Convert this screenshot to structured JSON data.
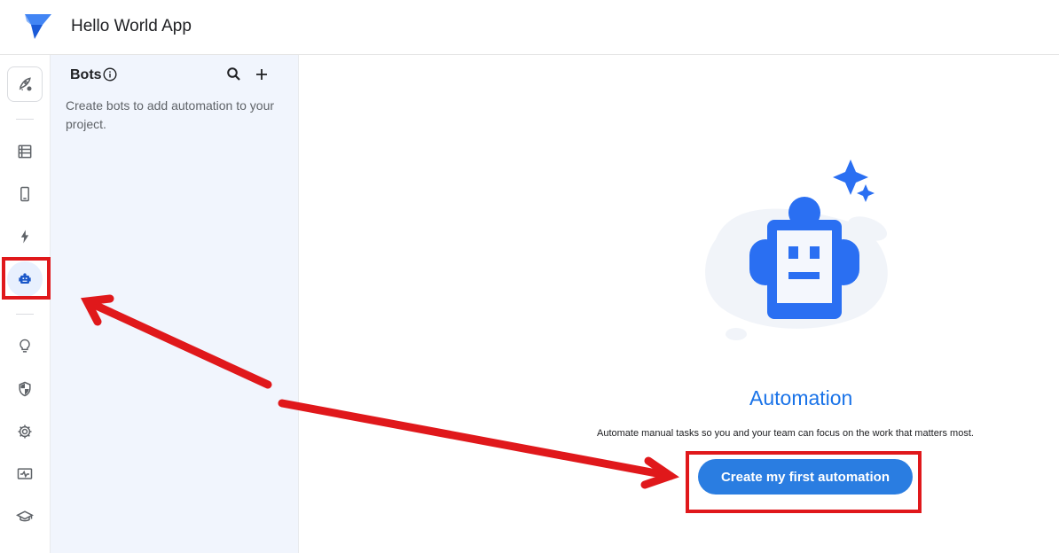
{
  "header": {
    "app_title": "Hello World App"
  },
  "rail": {
    "items": [
      {
        "name": "launch",
        "icon": "rocket-icon"
      },
      {
        "name": "data",
        "icon": "table-icon"
      },
      {
        "name": "views",
        "icon": "phone-icon"
      },
      {
        "name": "actions",
        "icon": "lightning-icon"
      },
      {
        "name": "automation",
        "icon": "robot-icon",
        "active": true
      },
      {
        "name": "intelligence",
        "icon": "lightbulb-icon"
      },
      {
        "name": "security",
        "icon": "shield-icon"
      },
      {
        "name": "settings",
        "icon": "gear-icon"
      },
      {
        "name": "monitor",
        "icon": "monitor-icon"
      },
      {
        "name": "learn",
        "icon": "graduation-cap-icon"
      }
    ]
  },
  "bots_panel": {
    "title": "Bots",
    "description": "Create bots to add automation to your project."
  },
  "main": {
    "heading": "Automation",
    "subtext": "Automate manual tasks so you and your team can focus on the work that matters most.",
    "cta_label": "Create my first automation"
  },
  "colors": {
    "accent": "#1a73e8",
    "button": "#2a7de1",
    "annotation": "#e0181b",
    "panel_bg": "#f1f5fd"
  }
}
